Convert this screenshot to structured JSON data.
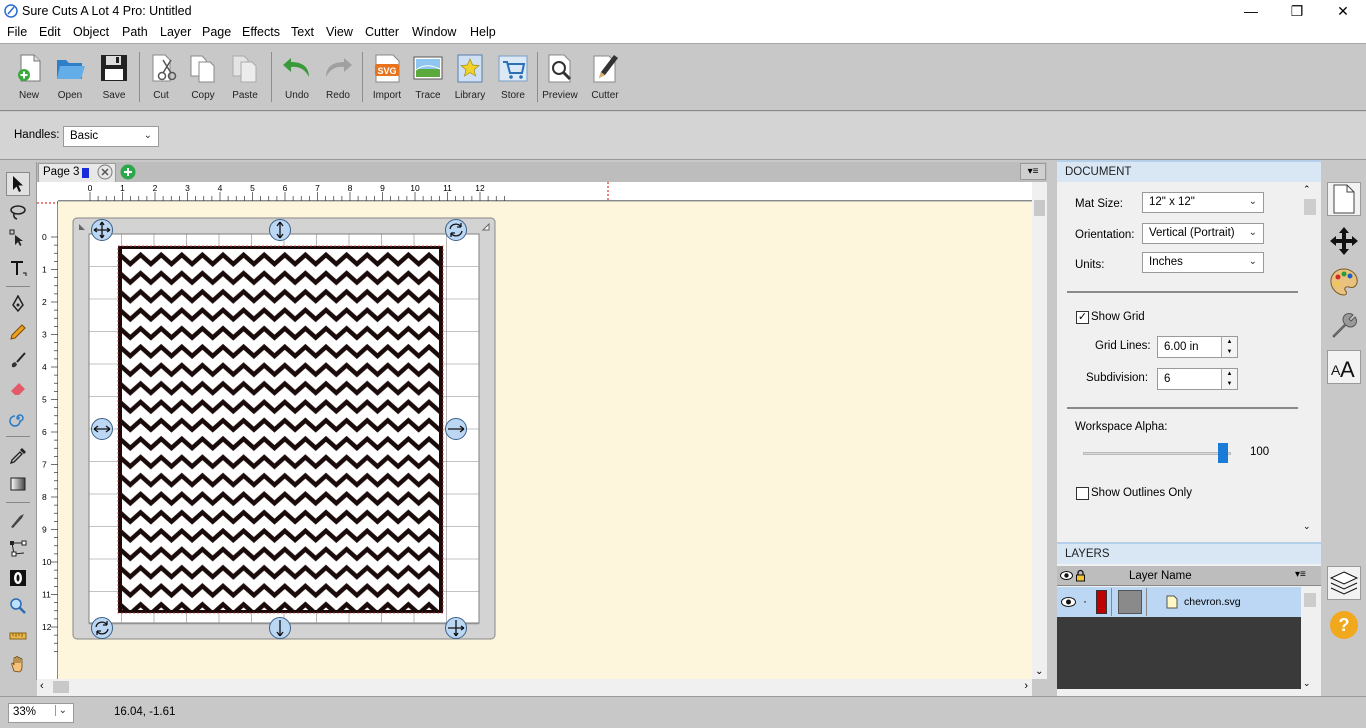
{
  "window": {
    "title": "Sure Cuts A Lot 4 Pro: Untitled",
    "controls": [
      "—",
      "❐",
      "✕"
    ]
  },
  "menu": [
    "File",
    "Edit",
    "Object",
    "Path",
    "Layer",
    "Page",
    "Effects",
    "Text",
    "View",
    "Cutter",
    "Window",
    "Help"
  ],
  "toolbar": {
    "new": "New",
    "open": "Open",
    "save": "Save",
    "cut": "Cut",
    "copy": "Copy",
    "paste": "Paste",
    "undo": "Undo",
    "redo": "Redo",
    "import": "Import",
    "trace": "Trace",
    "library": "Library",
    "store": "Store",
    "preview": "Preview",
    "cutter": "Cutter",
    "svg_badge": "SVG"
  },
  "handles": {
    "label": "Handles:",
    "value": "Basic"
  },
  "page_tab": {
    "label": "Page 3"
  },
  "ruler": {
    "top": [
      "0",
      "1",
      "2",
      "3",
      "4",
      "5",
      "6",
      "7",
      "8",
      "9",
      "10",
      "11",
      "12"
    ],
    "left": [
      "0",
      "1",
      "2",
      "3",
      "4",
      "5",
      "6",
      "7",
      "8",
      "9",
      "10",
      "11",
      "12"
    ]
  },
  "document": {
    "header": "DOCUMENT",
    "mat_size_label": "Mat Size:",
    "mat_size": "12\" x 12\"",
    "orientation_label": "Orientation:",
    "orientation": "Vertical (Portrait)",
    "units_label": "Units:",
    "units": "Inches",
    "show_grid_label": "Show Grid",
    "show_grid_checked": true,
    "grid_lines_label": "Grid Lines:",
    "grid_lines": "6.00 in",
    "subdivision_label": "Subdivision:",
    "subdivision": "6",
    "workspace_alpha_label": "Workspace Alpha:",
    "workspace_alpha": "100",
    "show_outlines_label": "Show Outlines Only",
    "show_outlines_checked": false
  },
  "layers": {
    "header": "LAYERS",
    "column": "Layer Name",
    "rows": [
      {
        "name": "chevron.svg",
        "color": "#c00000"
      }
    ]
  },
  "status": {
    "zoom": "33%",
    "coords": "16.04, -1.61"
  },
  "colors": {
    "canvas_bg": "#fdf6dc",
    "panel_header": "#d9e7f5",
    "selection": "#bcd7f3",
    "accent_blue": "#1b7bd8"
  }
}
